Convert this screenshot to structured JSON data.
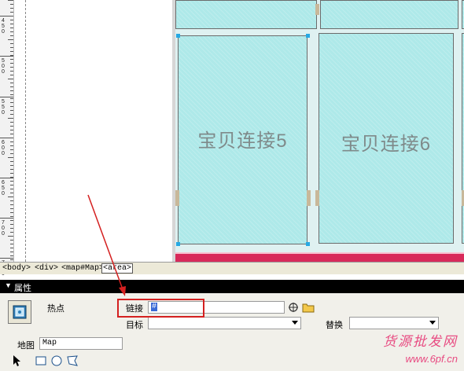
{
  "ruler": {
    "labels": [
      "450",
      "500",
      "550",
      "600",
      "650",
      "700",
      "750"
    ]
  },
  "canvas": {
    "cell5_label": "宝贝连接5",
    "cell6_label": "宝贝连接6"
  },
  "tag_selector": {
    "tags": [
      "<body>",
      "<div>",
      "<map#Map>",
      "<area>"
    ],
    "selected_index": 3
  },
  "properties": {
    "header_title": "属性",
    "hotspot_label": "热点",
    "link_label": "链接",
    "link_value": "#",
    "target_label": "目标",
    "target_value": "",
    "alt_label": "替换",
    "alt_value": "",
    "map_label": "地图",
    "map_value": "Map",
    "icons": [
      "point-to-hotspot-icon",
      "rect-hotspot-icon",
      "circle-hotspot-icon",
      "polygon-hotspot-icon",
      "folder-icon",
      "point-to-file-icon"
    ]
  },
  "watermark": {
    "line1": "货源批发网",
    "line2": "www.6pf.cn"
  },
  "colors": {
    "annotation_red": "#d42020",
    "hotspot_fill": "#aee9e9",
    "selection_handle": "#27a9e3"
  }
}
